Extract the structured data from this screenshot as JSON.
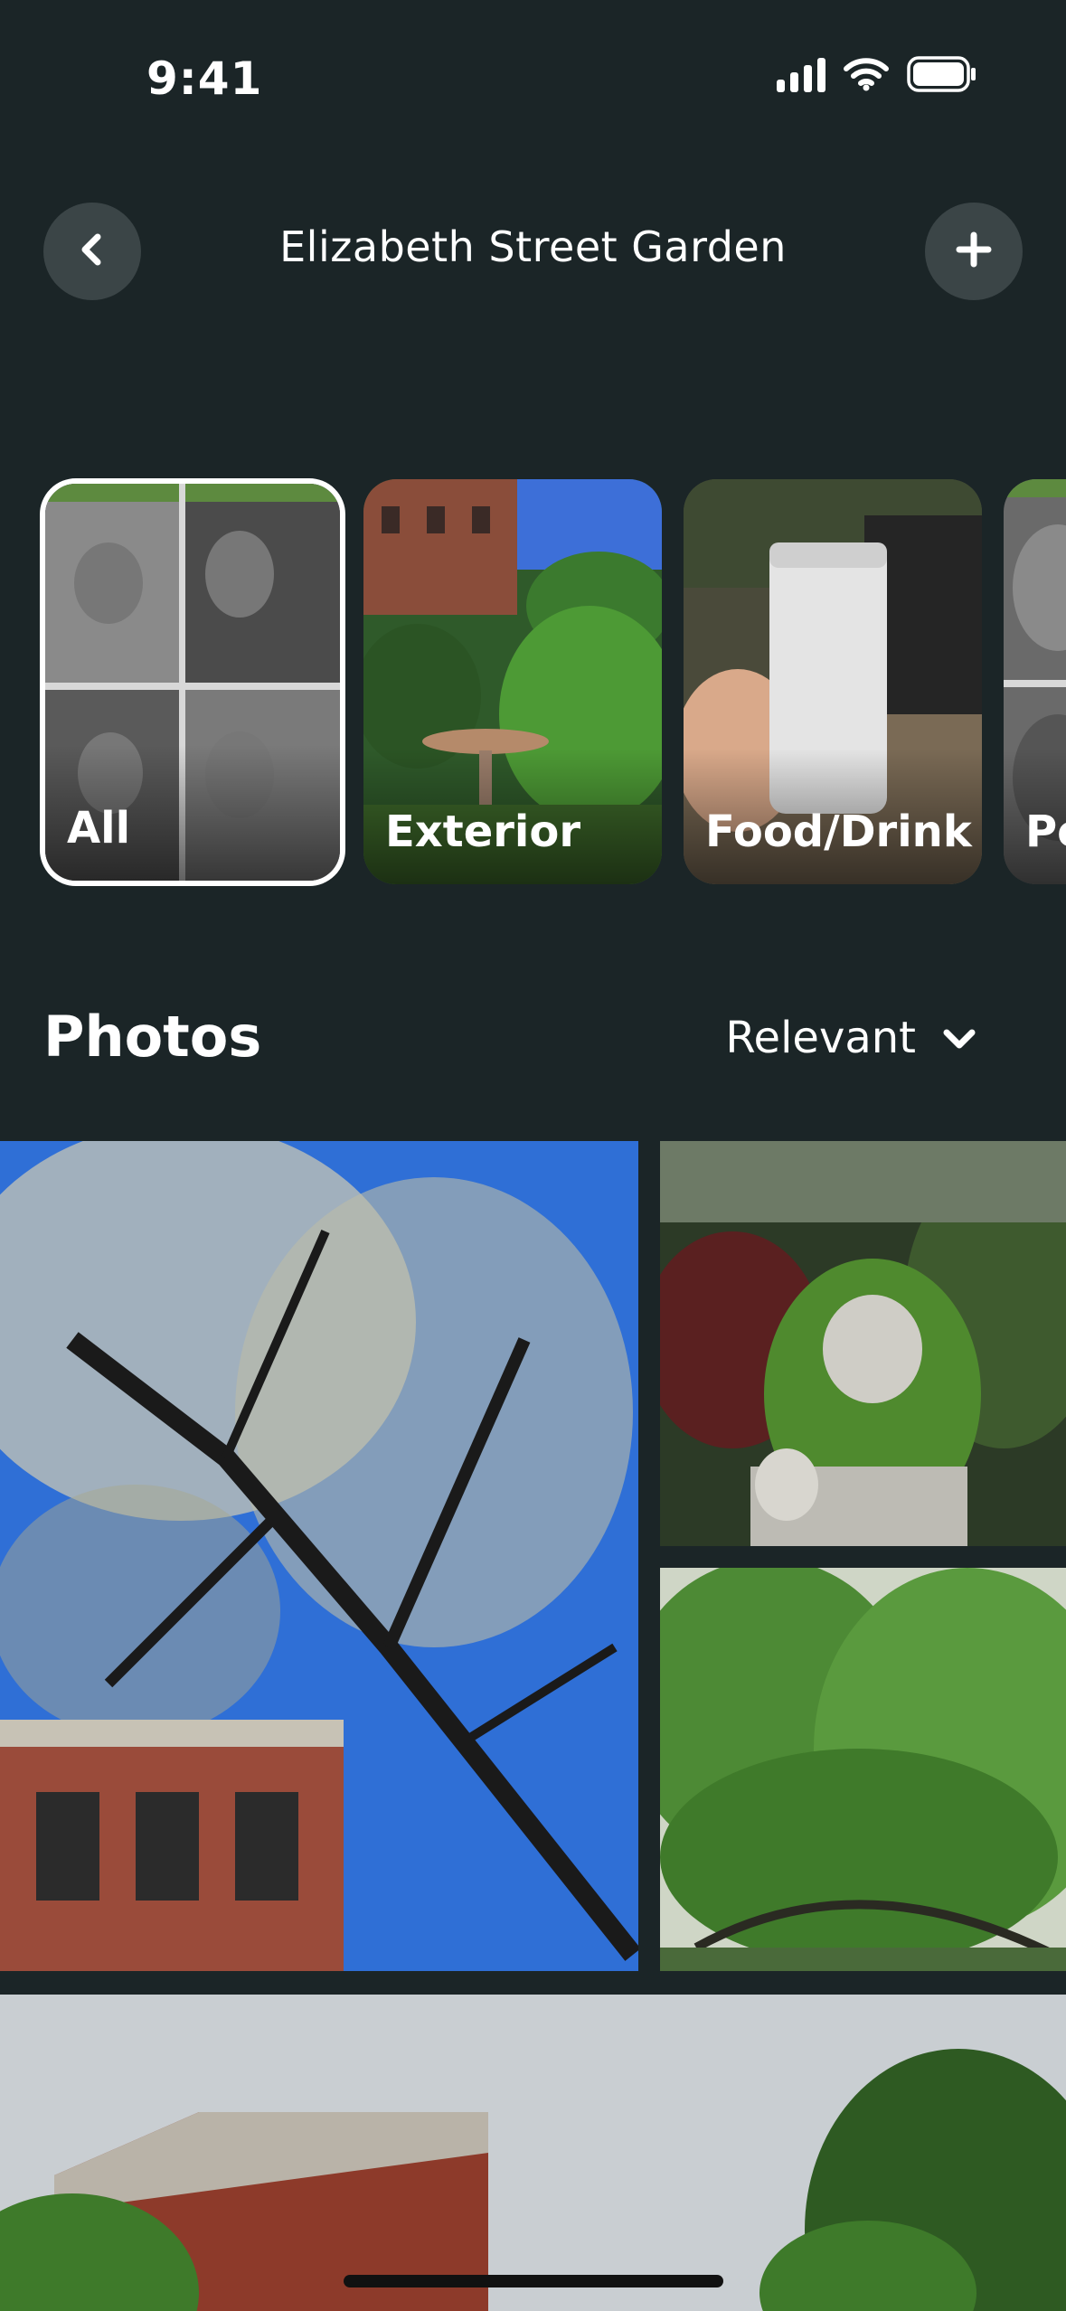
{
  "status_bar": {
    "time": "9:41"
  },
  "header": {
    "title": "Elizabeth Street Garden"
  },
  "categories": [
    {
      "label": "All",
      "selected": true
    },
    {
      "label": "Exterior",
      "selected": false
    },
    {
      "label": "Food/Drink",
      "selected": false
    },
    {
      "label": "Pe",
      "selected": false
    }
  ],
  "photos_section": {
    "title": "Photos",
    "sort_label": "Relevant"
  },
  "icons": {
    "back": "chevron-left-icon",
    "add": "plus-icon",
    "sort": "chevron-down-icon"
  },
  "colors": {
    "background": "#1b2527",
    "button": "#3b4547",
    "text": "#ffffff"
  }
}
